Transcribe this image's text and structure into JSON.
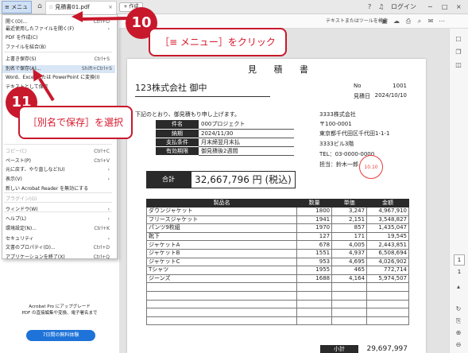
{
  "top_bar": {
    "menu_label": "≡ メニュー",
    "doc_tab_title": "見積書01.pdf",
    "create_label": "+ 作成",
    "login_label": "ログイン",
    "window_controls": [
      "−",
      "□",
      "×"
    ]
  },
  "toolbar": {
    "search_label": "テキストまたはツールを検索"
  },
  "menu": {
    "items": [
      {
        "label": "開く(O)...",
        "shortcut": "Ctrl+O"
      },
      {
        "label": "最近使用したファイルを開く(F)",
        "shortcut": "",
        "arrow": true
      },
      {
        "label": "PDF を作成(C)",
        "shortcut": ""
      },
      {
        "label": "ファイルを結合(B)",
        "shortcut": ""
      },
      {
        "label": "上書き保存(S)",
        "shortcut": "Ctrl+S"
      },
      {
        "label": "別名で保存(A)...",
        "shortcut": "Shift+Ctrl+S",
        "highlighted": true
      },
      {
        "label": "Word、Excel または PowerPoint に変換(I)",
        "shortcut": ""
      },
      {
        "label": "テキストとして保存",
        "shortcut": ""
      },
      {
        "label": "コピー(C)",
        "shortcut": "Ctrl+C",
        "dim": true
      },
      {
        "label": "ペースト(P)",
        "shortcut": "Ctrl+V"
      },
      {
        "label": "元に戻す、やり直しなど(U)",
        "shortcut": "",
        "arrow": true
      },
      {
        "label": "表示(V)",
        "shortcut": "",
        "arrow": true
      },
      {
        "label": "新しい Acrobat Reader を無効にする",
        "shortcut": ""
      },
      {
        "label": "プラグイン(G)",
        "shortcut": "",
        "dim": true
      },
      {
        "label": "ウィンドウ(W)",
        "shortcut": "",
        "arrow": true
      },
      {
        "label": "ヘルプ(L)",
        "shortcut": "",
        "arrow": true
      },
      {
        "label": "環境設定(N)...",
        "shortcut": "Ctrl+K"
      },
      {
        "label": "セキュリティ",
        "shortcut": "",
        "arrow": true
      },
      {
        "label": "文書のプロパティ(D)...",
        "shortcut": "Ctrl+D"
      },
      {
        "label": "アプリケーションを終了(X)",
        "shortcut": "Ctrl+Q"
      }
    ],
    "promo_line1": "Acrobat Pro にアップグレード",
    "promo_line2": "PDF の直接編集や変換、電子署名まで",
    "promo_button": "7日間の無料体験"
  },
  "callouts": {
    "step10_number": "10",
    "step10_text": "［≡ メニュー］をクリック",
    "step11_number": "11",
    "step11_text": "［別名で保存］を選択"
  },
  "document": {
    "title": "見 積 書",
    "client": "123株式会社 御中",
    "no_label": "No",
    "no_value": "1001",
    "date_label": "見積日",
    "date_value": "2024/10/10",
    "note": "下記のとおり、御見積もり申し上げます。",
    "info": [
      {
        "key": "件名",
        "value": "000プロジェクト"
      },
      {
        "key": "納期",
        "value": "2024/11/30"
      },
      {
        "key": "支払条件",
        "value": "月末締翌月末払"
      },
      {
        "key": "有効期限",
        "value": "御見積後2週間"
      }
    ],
    "vendor": {
      "name": "3333株式会社",
      "postal": "〒100-0001",
      "address": "東京都千代田区千代田1-1-1",
      "building": "3333ビル3階",
      "tel": "TEL：03-0000-0000",
      "person": "担当：鈴木一郎",
      "stamp": "10.10"
    },
    "total_label": "合計",
    "total_value": "32,667,796 円 (税込)",
    "headers": [
      "製品名",
      "数量",
      "単価",
      "金額"
    ],
    "rows": [
      [
        "ダウンジャケット",
        "1800",
        "3,247",
        "4,967,910"
      ],
      [
        "フリースジャケット",
        "1941",
        "2,151",
        "3,548,827"
      ],
      [
        "パンツ9枚組",
        "1970",
        "857",
        "1,435,047"
      ],
      [
        "靴下",
        "127",
        "171",
        "19,545"
      ],
      [
        "ジャケットA",
        "678",
        "4,005",
        "2,443,851"
      ],
      [
        "ジャケットB",
        "1551",
        "4,937",
        "6,508,694"
      ],
      [
        "ジャケットC",
        "953",
        "4,695",
        "4,026,902"
      ],
      [
        "Tシャツ",
        "1955",
        "465",
        "772,714"
      ],
      [
        "ジーンズ",
        "1688",
        "4,164",
        "5,974,507"
      ],
      [
        "",
        "",
        "",
        ""
      ],
      [
        "",
        "",
        "",
        ""
      ],
      [
        "",
        "",
        "",
        ""
      ],
      [
        "",
        "",
        "",
        ""
      ],
      [
        "",
        "",
        "",
        ""
      ]
    ],
    "subtotal_label": "小計",
    "subtotal_value": "29,697,997"
  },
  "rail": {
    "page_current": "1",
    "page_total": "1"
  },
  "colors": {
    "accent_red": "#c8182c",
    "menu_highlight": "#d8e6f6",
    "promo_blue": "#1e73d9"
  }
}
